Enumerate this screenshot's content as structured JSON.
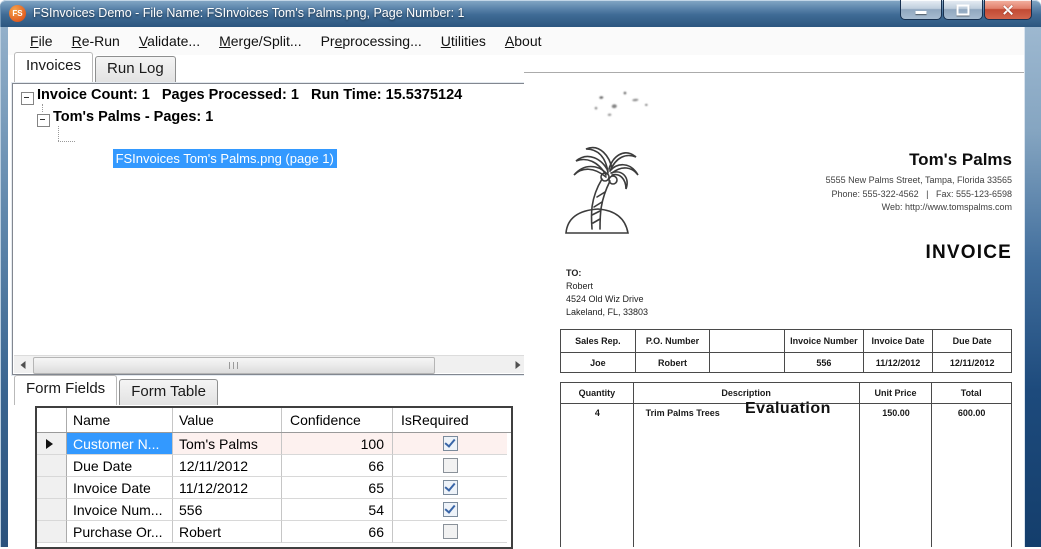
{
  "window": {
    "title": "FSInvoices Demo - File Name: FSInvoices Tom's Palms.png, Page Number: 1",
    "logo": "FS"
  },
  "menu": {
    "items": [
      {
        "pre": "",
        "key": "F",
        "post": "ile"
      },
      {
        "pre": "",
        "key": "R",
        "post": "e-Run"
      },
      {
        "pre": "",
        "key": "V",
        "post": "alidate..."
      },
      {
        "pre": "",
        "key": "M",
        "post": "erge/Split..."
      },
      {
        "pre": "Pr",
        "key": "e",
        "post": "processing..."
      },
      {
        "pre": "",
        "key": "U",
        "post": "tilities"
      },
      {
        "pre": "",
        "key": "A",
        "post": "bout"
      }
    ]
  },
  "main_tabs": {
    "invoices": "Invoices",
    "run_log": "Run Log"
  },
  "tree": {
    "root": "Invoice Count: 1   Pages Processed: 1   Run Time: 15.5375124",
    "group": "Tom's Palms - Pages: 1",
    "leaf": "FSInvoices Tom's Palms.png (page 1)"
  },
  "field_tabs": {
    "form_fields": "Form Fields",
    "form_table": "Form Table"
  },
  "grid": {
    "columns": [
      "Name",
      "Value",
      "Confidence",
      "IsRequired"
    ],
    "rows": [
      {
        "name": "Customer N...",
        "value": "Tom's Palms",
        "confidence": "100",
        "required": true,
        "selected": true
      },
      {
        "name": "Due Date",
        "value": "12/11/2012",
        "confidence": "66",
        "required": false,
        "selected": false
      },
      {
        "name": "Invoice Date",
        "value": "11/12/2012",
        "confidence": "65",
        "required": true,
        "selected": false
      },
      {
        "name": "Invoice Num...",
        "value": "556",
        "confidence": "54",
        "required": true,
        "selected": false
      },
      {
        "name": "Purchase Or...",
        "value": "Robert",
        "confidence": "66",
        "required": false,
        "selected": false
      }
    ]
  },
  "invoice": {
    "company": "Tom's Palms",
    "address": "5555 New Palms Street, Tampa, Florida 33565",
    "phone_fax": "Phone: 555-322-4562   |   Fax: 555-123-6598",
    "web": "Web: http://www.tomspalms.com",
    "doc_title": "INVOICE",
    "to_label": "TO:",
    "to_name": "Robert",
    "to_street": "4524 Old Wiz Drive",
    "to_city": "Lakeland, FL, 33803",
    "info_headers": [
      "Sales Rep.",
      "P.O. Number",
      "",
      "Invoice Number",
      "Invoice Date",
      "Due Date"
    ],
    "info_values": [
      "Joe",
      "Robert",
      "",
      "556",
      "11/12/2012",
      "12/11/2012"
    ],
    "item_headers": [
      "Quantity",
      "Description",
      "Unit Price",
      "Total"
    ],
    "item_row": [
      "4",
      "Trim Palms Trees",
      "150.00",
      "600.00"
    ],
    "watermark": "Evaluation"
  },
  "colors": {
    "selection_blue": "#3399ff",
    "current_row_pink": "#fdf1ef",
    "titlebar_blue": "#3f6b95",
    "close_button_red": "#c14a34",
    "logo_orange": "#e05f22"
  }
}
